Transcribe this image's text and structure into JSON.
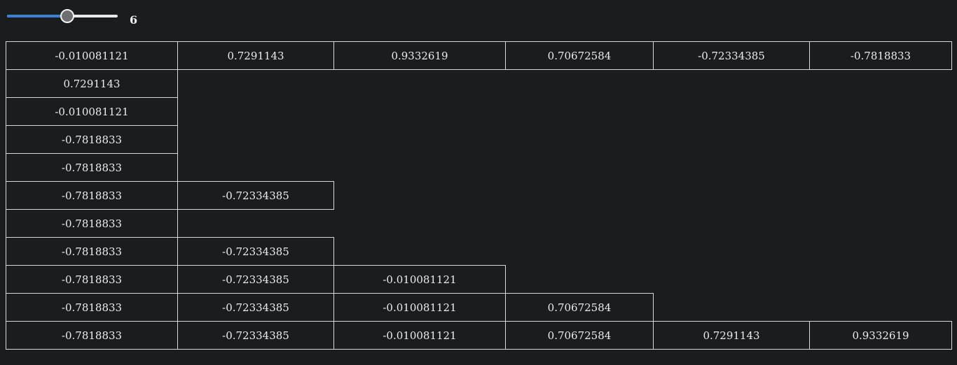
{
  "slider": {
    "value": 6,
    "min": 0,
    "max": 11,
    "value_label": "6",
    "accent_color": "#3b82d6"
  },
  "grid": {
    "rows": [
      [
        "-0.010081121",
        "0.7291143",
        "0.9332619",
        "0.70672584",
        "-0.72334385",
        "-0.7818833"
      ],
      [
        "0.7291143"
      ],
      [
        "-0.010081121"
      ],
      [
        "-0.7818833"
      ],
      [
        "-0.7818833"
      ],
      [
        "-0.7818833",
        "-0.72334385"
      ],
      [
        "-0.7818833"
      ],
      [
        "-0.7818833",
        "-0.72334385"
      ],
      [
        "-0.7818833",
        "-0.72334385",
        "-0.010081121"
      ],
      [
        "-0.7818833",
        "-0.72334385",
        "-0.010081121",
        "0.70672584"
      ],
      [
        "-0.7818833",
        "-0.72334385",
        "-0.010081121",
        "0.70672584",
        "0.7291143",
        "0.9332619"
      ]
    ]
  }
}
